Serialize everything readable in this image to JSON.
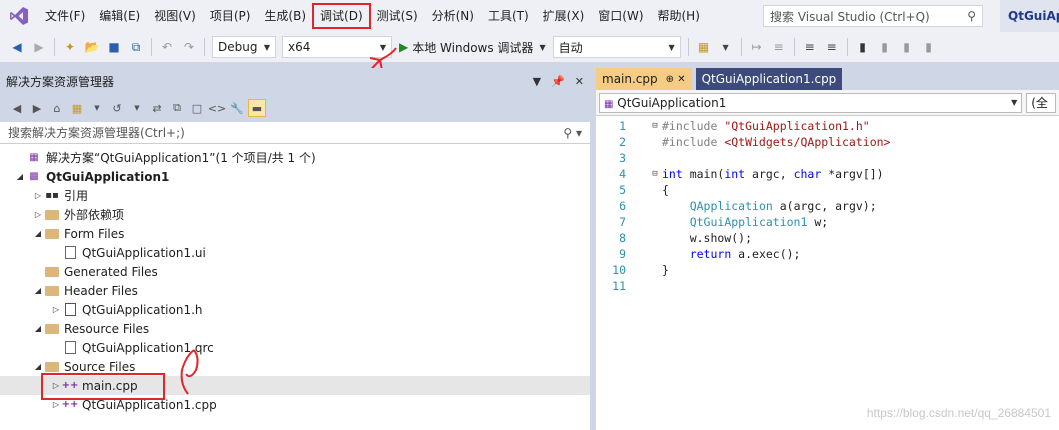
{
  "menubar": {
    "items": [
      "文件(F)",
      "编辑(E)",
      "视图(V)",
      "项目(P)",
      "生成(B)",
      "调试(D)",
      "测试(S)",
      "分析(N)",
      "工具(T)",
      "扩展(X)",
      "窗口(W)",
      "帮助(H)"
    ],
    "highlighted_index": 5,
    "search_placeholder": "搜索 Visual Studio (Ctrl+Q)",
    "app_title": "QtGuiAp"
  },
  "toolbar": {
    "config": "Debug",
    "platform": "x64",
    "run_label": "本地 Windows 调试器",
    "auto": "自动"
  },
  "solution_explorer": {
    "title": "解决方案资源管理器",
    "search_placeholder": "搜索解决方案资源管理器(Ctrl+;)",
    "tree": [
      {
        "label": "解决方案“QtGuiApplication1”(1 个项目/共 1 个)",
        "depth": 0,
        "exp": "",
        "icon": "solution",
        "bold": false
      },
      {
        "label": "QtGuiApplication1",
        "depth": 0,
        "exp": "open",
        "icon": "project",
        "bold": true
      },
      {
        "label": "引用",
        "depth": 1,
        "exp": "closed",
        "icon": "references",
        "bold": false
      },
      {
        "label": "外部依赖项",
        "depth": 1,
        "exp": "closed",
        "icon": "external",
        "bold": false
      },
      {
        "label": "Form Files",
        "depth": 1,
        "exp": "open",
        "icon": "folder",
        "bold": false
      },
      {
        "label": "QtGuiApplication1.ui",
        "depth": 2,
        "exp": "",
        "icon": "file",
        "bold": false
      },
      {
        "label": "Generated Files",
        "depth": 1,
        "exp": "",
        "icon": "folder",
        "bold": false
      },
      {
        "label": "Header Files",
        "depth": 1,
        "exp": "open",
        "icon": "folder",
        "bold": false
      },
      {
        "label": "QtGuiApplication1.h",
        "depth": 2,
        "exp": "closed",
        "icon": "header",
        "bold": false
      },
      {
        "label": "Resource Files",
        "depth": 1,
        "exp": "open",
        "icon": "folder",
        "bold": false
      },
      {
        "label": "QtGuiApplication1.qrc",
        "depth": 2,
        "exp": "",
        "icon": "file",
        "bold": false
      },
      {
        "label": "Source Files",
        "depth": 1,
        "exp": "open",
        "icon": "folder",
        "bold": false
      },
      {
        "label": "main.cpp",
        "depth": 2,
        "exp": "closed",
        "icon": "cpp",
        "bold": false,
        "selected": true
      },
      {
        "label": "QtGuiApplication1.cpp",
        "depth": 2,
        "exp": "closed",
        "icon": "cpp",
        "bold": false
      }
    ]
  },
  "editor": {
    "tabs": [
      {
        "label": "main.cpp",
        "active": true
      },
      {
        "label": "QtGuiApplication1.cpp",
        "active": false
      }
    ],
    "nav_scope": "QtGuiApplication1",
    "nav_right": "(全",
    "lines": [
      {
        "n": "1",
        "fold": "⊟",
        "html": "<span class=\"cmt\">#include </span><span class=\"str\">\"QtGuiApplication1.h\"</span>"
      },
      {
        "n": "2",
        "fold": "",
        "html": "<span class=\"cmt\">#include </span><span class=\"str\">&lt;QtWidgets/QApplication&gt;</span>"
      },
      {
        "n": "3",
        "fold": "",
        "html": ""
      },
      {
        "n": "4",
        "fold": "⊟",
        "html": "<span class=\"kw\">int</span> main(<span class=\"kw\">int</span> argc, <span class=\"kw\">char</span> *argv[])"
      },
      {
        "n": "5",
        "fold": "",
        "html": "{"
      },
      {
        "n": "6",
        "fold": "",
        "html": "    <span class=\"ty\">QApplication</span> a(argc, argv);"
      },
      {
        "n": "7",
        "fold": "",
        "html": "    <span class=\"ty\">QtGuiApplication1</span> w;"
      },
      {
        "n": "8",
        "fold": "",
        "html": "    w.show();"
      },
      {
        "n": "9",
        "fold": "",
        "html": "    <span class=\"kw\">return</span> a.exec();"
      },
      {
        "n": "10",
        "fold": "",
        "html": "}"
      },
      {
        "n": "11",
        "fold": "",
        "html": ""
      }
    ]
  },
  "watermark": "https://blog.csdn.net/qq_26884501"
}
